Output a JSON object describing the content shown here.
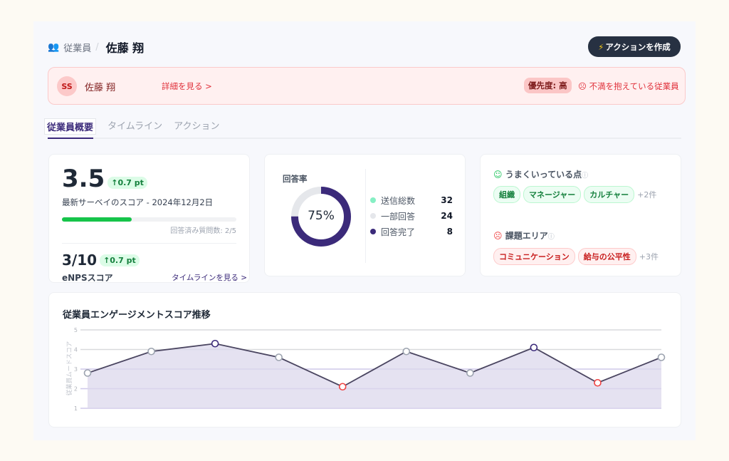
{
  "breadcrumb": {
    "parent": "従業員",
    "current": "佐藤 翔"
  },
  "create_button": {
    "icon": "lightning-icon",
    "label": "アクションを作成"
  },
  "alert": {
    "initials": "SS",
    "name": "佐藤 翔",
    "detail_link": "詳細を見る >",
    "priority": "優先度: 高",
    "status": "不満を抱えている従業員",
    "status_icon": "sad-face-icon"
  },
  "tabs": [
    "従業員概要",
    "タイムライン",
    "アクション"
  ],
  "score_card": {
    "score": "3.5",
    "delta": "↑0.7 pt",
    "caption": "最新サーベイのスコア - 2024年12月2日",
    "progress": 0.4,
    "progress_label": "回答済み質問数: 2/5",
    "enps": "3/10",
    "enps_delta": "↑0.7 pt",
    "enps_label": "eNPSスコア",
    "timeline_link": "タイムラインを見る >"
  },
  "response_card": {
    "title": "回答率",
    "percent": 75,
    "percent_label": "75%",
    "legend": [
      {
        "label": "送信総数",
        "value": "32",
        "color": "#86efc4"
      },
      {
        "label": "一部回答",
        "value": "24",
        "color": "#e5e7eb"
      },
      {
        "label": "回答完了",
        "value": "8",
        "color": "#3b2a7a"
      }
    ]
  },
  "insights": {
    "good_title": "うまくいっている点",
    "good_tags": [
      "組織",
      "マネージャー",
      "カルチャー"
    ],
    "good_more": "+2件",
    "bad_title": "課題エリア",
    "bad_tags": [
      "コミュニケーション",
      "給与の公平性"
    ],
    "bad_more": "+3件"
  },
  "chart_data": {
    "type": "area",
    "title": "従業員エンゲージメントスコア推移",
    "ylabel": "従業員ムードスコア",
    "xlabel": "",
    "ylim": [
      1,
      5
    ],
    "yticks": [
      "1",
      "2",
      "3",
      "4",
      "5"
    ],
    "grid": true,
    "values": [
      2.8,
      3.9,
      4.3,
      3.6,
      2.1,
      3.9,
      2.8,
      4.1,
      2.3,
      3.6
    ],
    "colors": {
      "line": "#4a4560",
      "fill": "#dcd8ec",
      "high": "#3b2a7a",
      "low": "#ef4444",
      "normal": "#9ca3af"
    }
  }
}
